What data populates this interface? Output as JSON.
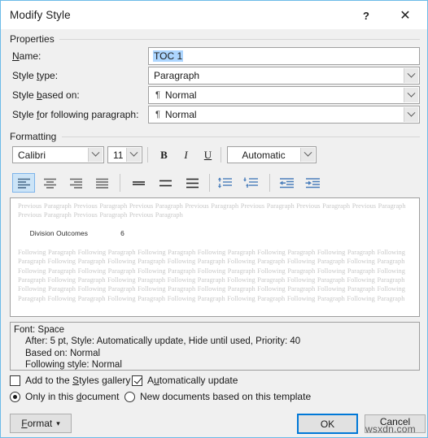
{
  "window": {
    "title": "Modify Style",
    "help_icon": "?",
    "close_icon": "✕"
  },
  "properties": {
    "group_label": "Properties",
    "name_label": "Name:",
    "name_value": "TOC 1",
    "style_type_label": "Style type:",
    "style_type_value": "Paragraph",
    "style_based_on_label": "Style based on:",
    "style_based_on_value": "Normal",
    "style_following_label": "Style for following paragraph:",
    "style_following_value": "Normal",
    "paragraph_mark": "¶"
  },
  "formatting": {
    "group_label": "Formatting",
    "font_family": "Calibri",
    "font_size": "11",
    "bold": "B",
    "italic": "I",
    "underline": "U",
    "font_color": "Automatic"
  },
  "preview": {
    "previous_paragraph": "Previous Paragraph Previous Paragraph Previous Paragraph Previous Paragraph Previous Paragraph Previous Paragraph Previous Paragraph Previous Paragraph Previous Paragraph Previous Paragraph",
    "sample_text": "Division Outcomes",
    "sample_page": "6",
    "following_paragraph": "Following Paragraph Following Paragraph Following Paragraph Following Paragraph Following Paragraph Following Paragraph Following Paragraph Following Paragraph Following Paragraph Following Paragraph Following Paragraph Following Paragraph Following Paragraph Following Paragraph Following Paragraph Following Paragraph Following Paragraph Following Paragraph Following Paragraph Following Paragraph Following Paragraph Following Paragraph Following Paragraph Following Paragraph Following Paragraph Following Paragraph Following Paragraph Following Paragraph Following Paragraph Following Paragraph Following Paragraph Following Paragraph Following Paragraph Following Paragraph Following Paragraph Following Paragraph Following Paragraph Following Paragraph Following Paragraph"
  },
  "description": {
    "line1": "Font: Space",
    "line2": "After:  5 pt, Style: Automatically update, Hide until used, Priority: 40",
    "line3": "Based on: Normal",
    "line4": "Following style: Normal"
  },
  "options": {
    "add_to_gallery": "Add to the Styles gallery",
    "automatically_update": "Automatically update",
    "only_this_document": "Only in this document",
    "new_documents": "New documents based on this template"
  },
  "buttons": {
    "format": "Format",
    "format_caret": "▾",
    "ok": "OK",
    "cancel": "Cancel"
  },
  "watermark": "wsxdn.com",
  "colors": {
    "accent_border": "#6cbbe8",
    "selection": "#add6ff",
    "focus": "#0078d7",
    "toolbar_selected": "#cce4f7",
    "icon_blue": "#4a7ebb"
  }
}
